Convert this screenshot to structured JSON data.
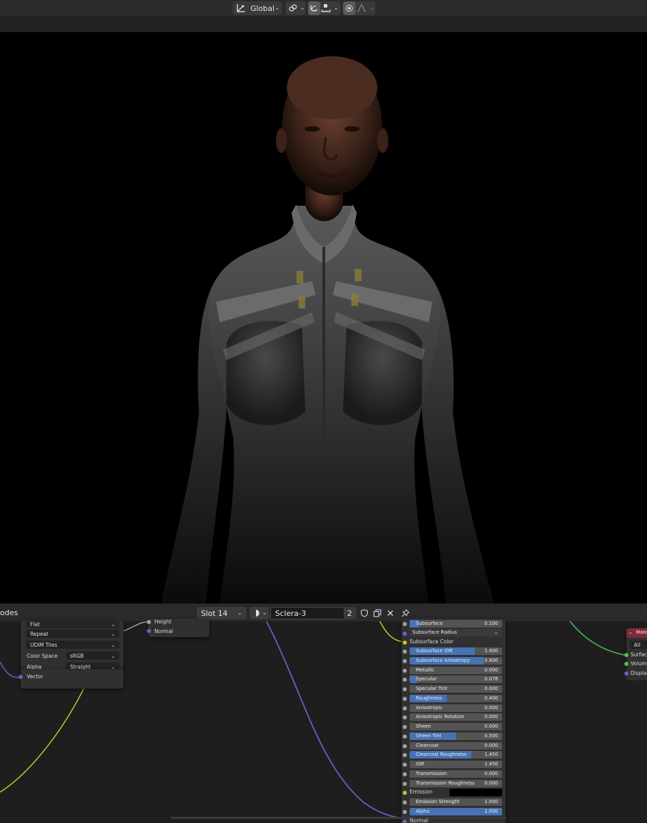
{
  "header": {
    "transform_orientation": "Global",
    "icons": [
      "transform-orientation-icon",
      "pivot-link-icon",
      "snap-magnet-icon",
      "snap-target-icon",
      "proportional-edit-icon",
      "falloff-curve-icon"
    ]
  },
  "node_editor": {
    "title_partial": "odes",
    "slot": "Slot 14",
    "material_name": "Sclera-3",
    "user_count": "2"
  },
  "image_node": {
    "interpolation": "Flat",
    "extension": "Repeat",
    "source": "UDIM Tiles",
    "color_space_label": "Color Space",
    "color_space": "sRGB",
    "alpha_label": "Alpha",
    "alpha": "Straight",
    "vector_label": "Vector"
  },
  "bump_node": {
    "height": "Height",
    "normal": "Normal"
  },
  "bsdf": {
    "subsurface": {
      "label": "Subsurface",
      "value": "0.100",
      "fill": 0.1
    },
    "subsurface_radius": "Subsurface Radius",
    "subsurface_color": "Subsurface Color",
    "rows": [
      {
        "label": "Subsurface IOR",
        "value": "1.400",
        "fill": 0.7
      },
      {
        "label": "Subsurface Anisotropy",
        "value": "0.800",
        "fill": 0.8
      },
      {
        "label": "Metallic",
        "value": "0.000",
        "fill": 0
      },
      {
        "label": "Specular",
        "value": "0.078",
        "fill": 0.078
      },
      {
        "label": "Specular Tint",
        "value": "0.000",
        "fill": 0
      },
      {
        "label": "Roughness",
        "value": "0.400",
        "fill": 0.4
      },
      {
        "label": "Anisotropic",
        "value": "0.000",
        "fill": 0
      },
      {
        "label": "Anisotropic Rotation",
        "value": "0.000",
        "fill": 0
      },
      {
        "label": "Sheen",
        "value": "0.000",
        "fill": 0
      },
      {
        "label": "Sheen Tint",
        "value": "0.500",
        "fill": 0.5
      },
      {
        "label": "Clearcoat",
        "value": "0.000",
        "fill": 0
      },
      {
        "label": "Clearcoat Roughness",
        "value": "1.450",
        "fill": 0.67
      },
      {
        "label": "IOR",
        "value": "1.450",
        "fill": 0
      },
      {
        "label": "Transmission",
        "value": "0.000",
        "fill": 0
      },
      {
        "label": "Transmission Roughness",
        "value": "0.000",
        "fill": 0
      }
    ],
    "emission": "Emission",
    "emission_strength": {
      "label": "Emission Strength",
      "value": "1.000",
      "fill": 0
    },
    "alpha": {
      "label": "Alpha",
      "value": "1.000",
      "fill": 1
    },
    "normal_partial": "Normal"
  },
  "output_node": {
    "title_partial": "Mate",
    "target": "All",
    "surface": "Surface",
    "volume": "Volume",
    "displacement": "Displace"
  },
  "colors": {
    "field_fill": "#4772b3",
    "socket_gray": "#a1a1a1",
    "socket_yellow": "#c7c729",
    "socket_blue": "#6363c7",
    "socket_green": "#4fc24f",
    "output_header": "#7d2b3a"
  }
}
